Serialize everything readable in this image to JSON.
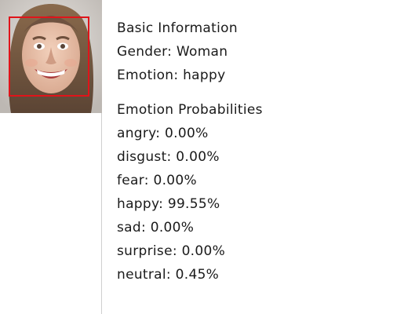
{
  "basic": {
    "title": "Basic Information",
    "gender": "Gender: Woman",
    "emotion": "Emotion: happy"
  },
  "probabilities": {
    "title": "Emotion Probabilities",
    "items": [
      "angry: 0.00%",
      "disgust: 0.00%",
      "fear: 0.00%",
      "happy: 99.55%",
      "sad: 0.00%",
      "surprise: 0.00%",
      "neutral: 0.45%"
    ]
  },
  "colors": {
    "face_box": "#e0141a",
    "text": "#1a1a1a",
    "divider": "#cfcfcf"
  },
  "icons": {
    "photo": "face-photo-icon"
  }
}
